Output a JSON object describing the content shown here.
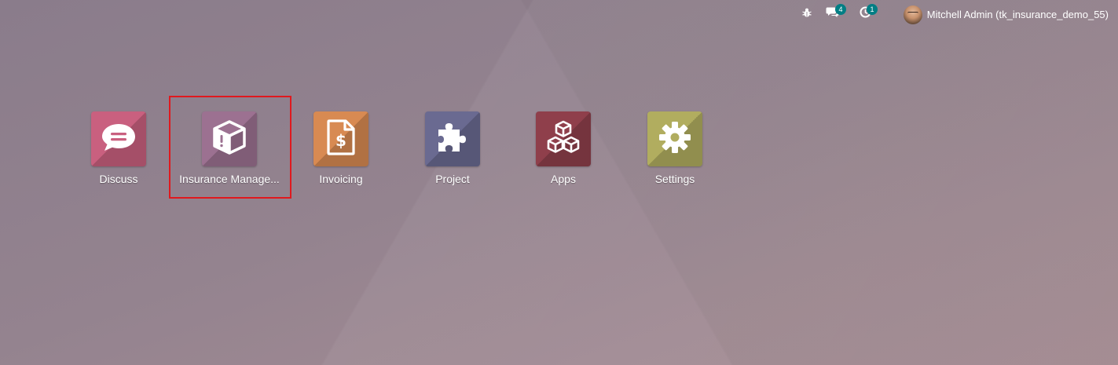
{
  "topbar": {
    "debug_icon": "bug-icon",
    "messages": {
      "icon": "chat-icon",
      "count": "4"
    },
    "activities": {
      "icon": "clock-icon",
      "count": "1"
    },
    "user": {
      "name": "Mitchell Admin (tk_insurance_demo_55)",
      "avatar": "avatar"
    }
  },
  "apps": [
    {
      "label": "Discuss",
      "icon": "chat-bubble-icon",
      "color": "#c9607f"
    },
    {
      "label": "Insurance Manage...",
      "icon": "box-warning-icon",
      "color": "#9c7191"
    },
    {
      "label": "Invoicing",
      "icon": "invoice-dollar-icon",
      "color": "#d88a52"
    },
    {
      "label": "Project",
      "icon": "puzzle-icon",
      "color": "#6a6a91"
    },
    {
      "label": "Apps",
      "icon": "cubes-icon",
      "color": "#8f3f4b"
    },
    {
      "label": "Settings",
      "icon": "gear-icon",
      "color": "#b1ad5f"
    }
  ],
  "colors": {
    "badge": "#017e84",
    "highlight": "#e0191e"
  }
}
